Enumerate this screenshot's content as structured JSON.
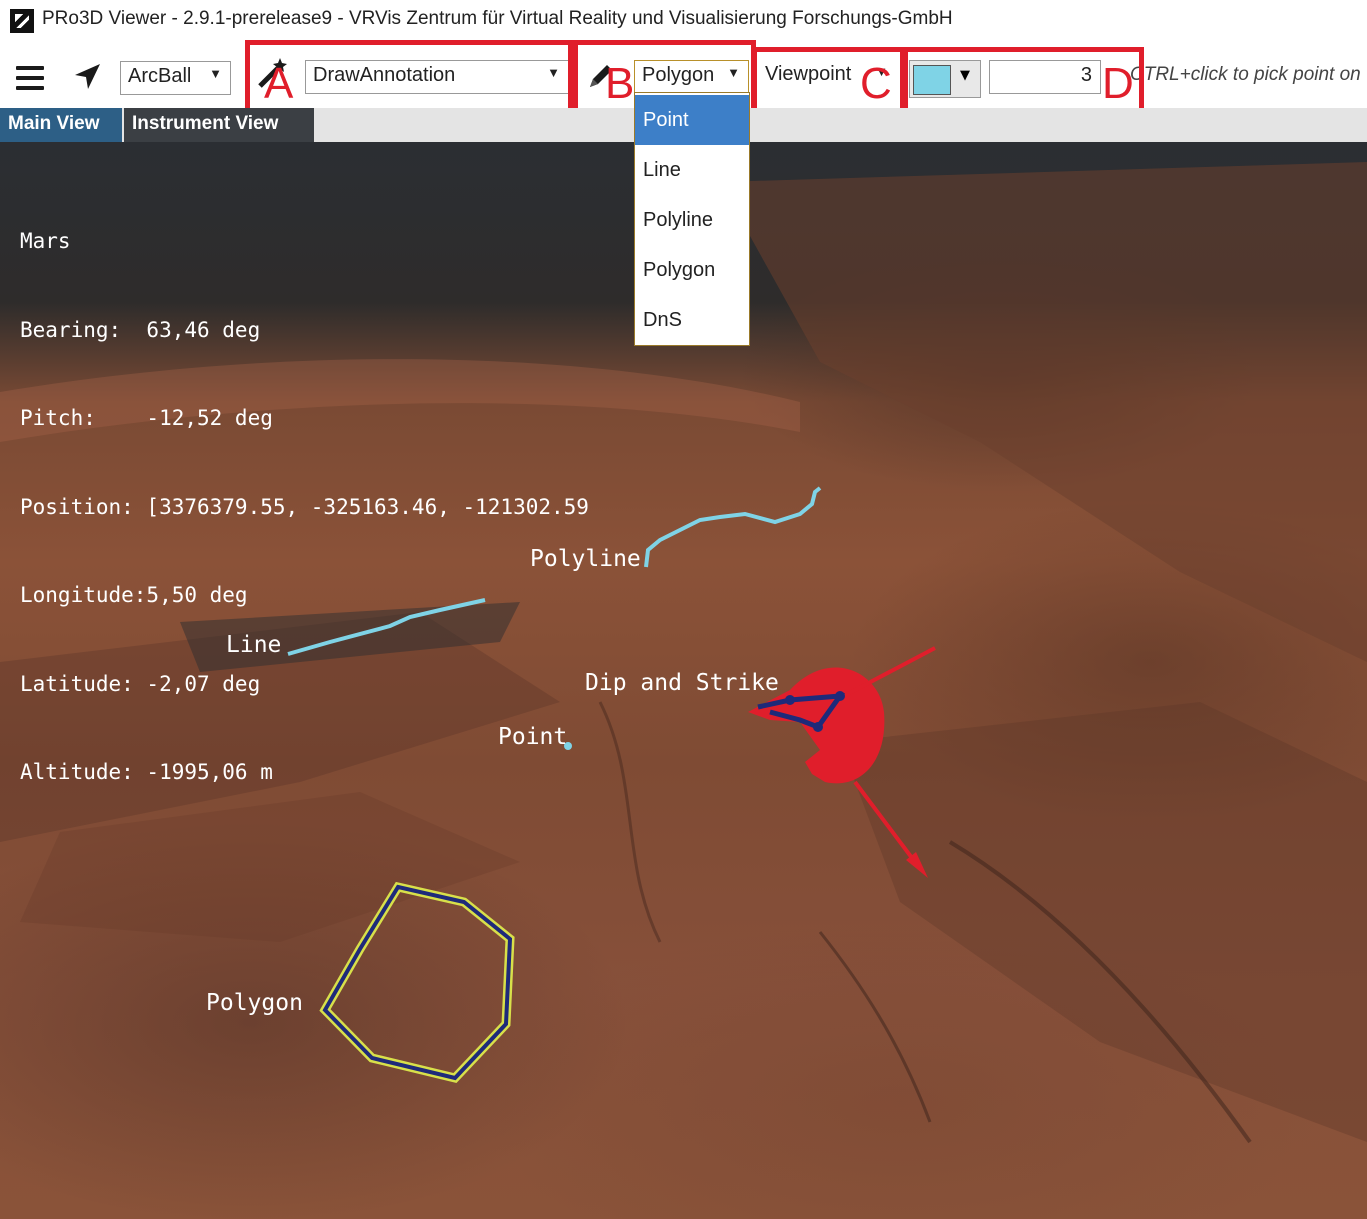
{
  "window": {
    "title": "PRo3D Viewer - 2.9.1-prerelease9 - VRVis Zentrum für Virtual Reality und Visualisierung Forschungs-GmbH"
  },
  "toolbar": {
    "navigation_mode": "ArcBall",
    "interaction_mode": "DrawAnnotation",
    "geometry_type": "Polygon",
    "projection": "Viewpoint",
    "color": "#7fd3e6",
    "thickness": "3",
    "hint": "CTRL+click to pick point on"
  },
  "annotation_labels": {
    "a": "A",
    "b": "B",
    "c": "C",
    "d": "D"
  },
  "geometry_dropdown": {
    "options": [
      "Point",
      "Line",
      "Polyline",
      "Polygon",
      "DnS"
    ],
    "highlighted": "Point"
  },
  "tabs": [
    "Main View",
    "Instrument View"
  ],
  "hud": {
    "lines": [
      "Mars",
      "Bearing:  63,46 deg",
      "Pitch:    -12,52 deg",
      "Position: [3376379.55, -325163.46, -121302.59",
      "Longitude:5,50 deg",
      "Latitude: -2,07 deg",
      "Altitude: -1995,06 m"
    ]
  },
  "scene": {
    "labels": {
      "polyline": "Polyline",
      "line": "Line",
      "dns": "Dip and Strike",
      "point": "Point",
      "polygon": "Polygon"
    },
    "annotation_color": "#7fd3e6",
    "polygon_outline_color": "#d8e04a",
    "polygon_fill_line_color": "#1e2a7a",
    "dns_color": "#e01e2b"
  }
}
